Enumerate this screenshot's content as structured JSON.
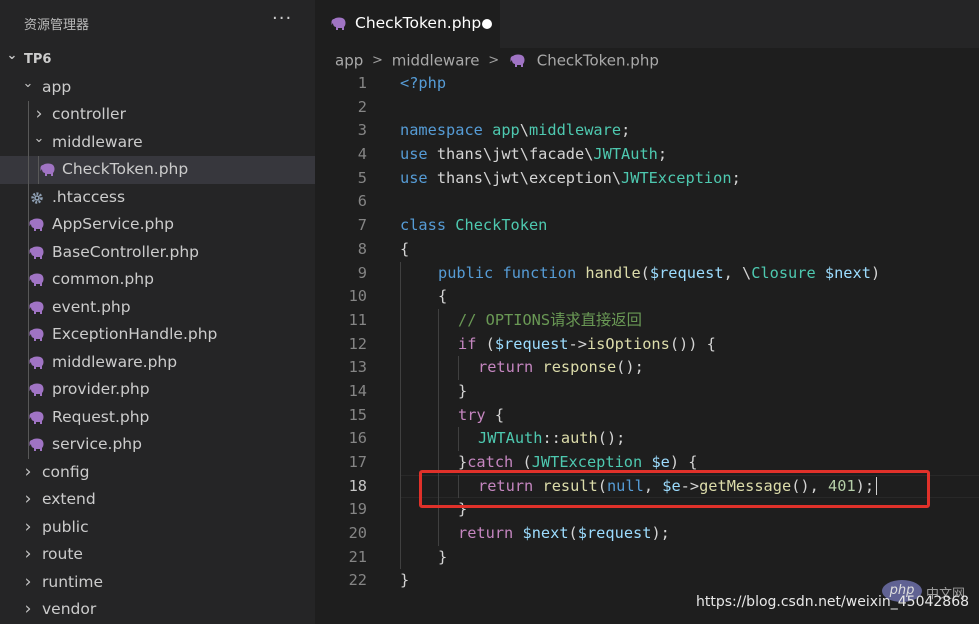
{
  "sidebar": {
    "title": "资源管理器",
    "more": "···",
    "tree": [
      {
        "label": "TP6",
        "type": "root-folder",
        "expanded": true,
        "depth": 0
      },
      {
        "label": "app",
        "type": "folder",
        "expanded": true,
        "depth": 1
      },
      {
        "label": "controller",
        "type": "folder",
        "expanded": false,
        "depth": 2
      },
      {
        "label": "middleware",
        "type": "folder",
        "expanded": true,
        "depth": 2
      },
      {
        "label": "CheckToken.php",
        "type": "php",
        "depth": 3,
        "selected": true
      },
      {
        "label": ".htaccess",
        "type": "gear",
        "depth": 2
      },
      {
        "label": "AppService.php",
        "type": "php",
        "depth": 2
      },
      {
        "label": "BaseController.php",
        "type": "php",
        "depth": 2
      },
      {
        "label": "common.php",
        "type": "php",
        "depth": 2
      },
      {
        "label": "event.php",
        "type": "php",
        "depth": 2
      },
      {
        "label": "ExceptionHandle.php",
        "type": "php",
        "depth": 2
      },
      {
        "label": "middleware.php",
        "type": "php",
        "depth": 2
      },
      {
        "label": "provider.php",
        "type": "php",
        "depth": 2
      },
      {
        "label": "Request.php",
        "type": "php",
        "depth": 2
      },
      {
        "label": "service.php",
        "type": "php",
        "depth": 2
      },
      {
        "label": "config",
        "type": "folder",
        "expanded": false,
        "depth": 1
      },
      {
        "label": "extend",
        "type": "folder",
        "expanded": false,
        "depth": 1
      },
      {
        "label": "public",
        "type": "folder",
        "expanded": false,
        "depth": 1
      },
      {
        "label": "route",
        "type": "folder",
        "expanded": false,
        "depth": 1
      },
      {
        "label": "runtime",
        "type": "folder",
        "expanded": false,
        "depth": 1
      },
      {
        "label": "vendor",
        "type": "folder",
        "expanded": false,
        "depth": 1
      }
    ]
  },
  "editor": {
    "tab": {
      "title": "CheckToken.php",
      "modified": true,
      "icon": "php-elephant-icon"
    },
    "breadcrumb": [
      "app",
      "middleware",
      "CheckToken.php"
    ],
    "active_line": 18,
    "lines": [
      {
        "no": "1",
        "indent": 0,
        "tokens": [
          [
            "k",
            "<?php"
          ]
        ]
      },
      {
        "no": "2",
        "indent": 0,
        "tokens": []
      },
      {
        "no": "3",
        "indent": 0,
        "tokens": [
          [
            "k",
            "namespace"
          ],
          [
            "p",
            " "
          ],
          [
            "t",
            "app"
          ],
          [
            "p",
            "\\"
          ],
          [
            "t",
            "middleware"
          ],
          [
            "p",
            ";"
          ]
        ]
      },
      {
        "no": "4",
        "indent": 0,
        "tokens": [
          [
            "k",
            "use"
          ],
          [
            "p",
            " thans\\jwt\\facade\\"
          ],
          [
            "t",
            "JWTAuth"
          ],
          [
            "p",
            ";"
          ]
        ]
      },
      {
        "no": "5",
        "indent": 0,
        "tokens": [
          [
            "k",
            "use"
          ],
          [
            "p",
            " thans\\jwt\\exception\\"
          ],
          [
            "t",
            "JWTException"
          ],
          [
            "p",
            ";"
          ]
        ]
      },
      {
        "no": "6",
        "indent": 0,
        "tokens": []
      },
      {
        "no": "7",
        "indent": 0,
        "tokens": [
          [
            "k",
            "class"
          ],
          [
            "p",
            " "
          ],
          [
            "t",
            "CheckToken"
          ]
        ]
      },
      {
        "no": "8",
        "indent": 0,
        "tokens": [
          [
            "p",
            "{"
          ]
        ]
      },
      {
        "no": "9",
        "indent": 1,
        "tokens": [
          [
            "k",
            "public"
          ],
          [
            "p",
            " "
          ],
          [
            "k",
            "function"
          ],
          [
            "p",
            " "
          ],
          [
            "f",
            "handle"
          ],
          [
            "p",
            "("
          ],
          [
            "v",
            "$request"
          ],
          [
            "p",
            ", \\"
          ],
          [
            "t",
            "Closure"
          ],
          [
            "p",
            " "
          ],
          [
            "v",
            "$next"
          ],
          [
            "p",
            ")"
          ]
        ]
      },
      {
        "no": "10",
        "indent": 1,
        "tokens": [
          [
            "p",
            "{"
          ]
        ]
      },
      {
        "no": "11",
        "indent": 2,
        "tokens": [
          [
            "cm",
            "// OPTIONS请求直接返回"
          ]
        ]
      },
      {
        "no": "12",
        "indent": 2,
        "tokens": [
          [
            "c",
            "if"
          ],
          [
            "p",
            " ("
          ],
          [
            "v",
            "$request"
          ],
          [
            "p",
            "->"
          ],
          [
            "f",
            "isOptions"
          ],
          [
            "p",
            "()) {"
          ]
        ]
      },
      {
        "no": "13",
        "indent": 3,
        "tokens": [
          [
            "c",
            "return"
          ],
          [
            "p",
            " "
          ],
          [
            "f",
            "response"
          ],
          [
            "p",
            "();"
          ]
        ]
      },
      {
        "no": "14",
        "indent": 2,
        "tokens": [
          [
            "p",
            "}"
          ]
        ]
      },
      {
        "no": "15",
        "indent": 2,
        "tokens": [
          [
            "c",
            "try"
          ],
          [
            "p",
            " {"
          ]
        ]
      },
      {
        "no": "16",
        "indent": 3,
        "tokens": [
          [
            "t",
            "JWTAuth"
          ],
          [
            "p",
            "::"
          ],
          [
            "f",
            "auth"
          ],
          [
            "p",
            "();"
          ]
        ]
      },
      {
        "no": "17",
        "indent": 2,
        "tokens": [
          [
            "p",
            "}"
          ],
          [
            "c",
            "catch"
          ],
          [
            "p",
            " ("
          ],
          [
            "t",
            "JWTException"
          ],
          [
            "p",
            " "
          ],
          [
            "v",
            "$e"
          ],
          [
            "p",
            ") {"
          ]
        ]
      },
      {
        "no": "18",
        "indent": 3,
        "tokens": [
          [
            "c",
            "return"
          ],
          [
            "p",
            " "
          ],
          [
            "f",
            "result"
          ],
          [
            "p",
            "("
          ],
          [
            "k",
            "null"
          ],
          [
            "p",
            ", "
          ],
          [
            "v",
            "$e"
          ],
          [
            "p",
            "->"
          ],
          [
            "f",
            "getMessage"
          ],
          [
            "p",
            "(), "
          ],
          [
            "n",
            "401"
          ],
          [
            "p",
            ");"
          ]
        ]
      },
      {
        "no": "19",
        "indent": 2,
        "tokens": [
          [
            "p",
            "}"
          ]
        ]
      },
      {
        "no": "20",
        "indent": 2,
        "tokens": [
          [
            "c",
            "return"
          ],
          [
            "p",
            " "
          ],
          [
            "v",
            "$next"
          ],
          [
            "p",
            "("
          ],
          [
            "v",
            "$request"
          ],
          [
            "p",
            ");"
          ]
        ]
      },
      {
        "no": "21",
        "indent": 1,
        "tokens": [
          [
            "p",
            "}"
          ]
        ]
      },
      {
        "no": "22",
        "indent": 0,
        "tokens": [
          [
            "p",
            "}"
          ]
        ]
      }
    ]
  },
  "watermark": {
    "url": "https://blog.csdn.net/weixin_45042868",
    "logo": "php",
    "logo_cn": "中文网"
  },
  "colors": {
    "accent_box": "#e0312a",
    "php_icon": "#a074c4",
    "sidebar_bg": "#252526",
    "editor_bg": "#1e1e1e"
  }
}
